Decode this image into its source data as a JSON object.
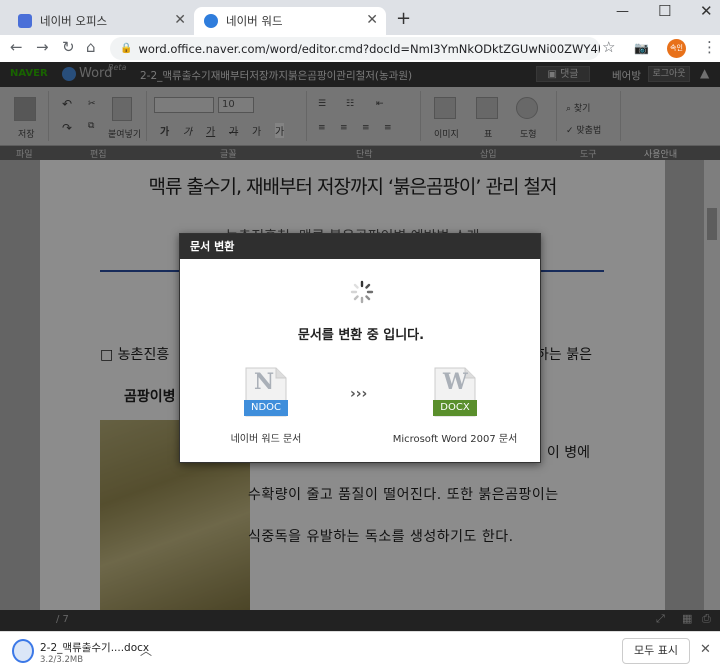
{
  "browser": {
    "tabs": [
      {
        "label": "네이버 오피스",
        "active": false
      },
      {
        "label": "네이버 워드",
        "active": true
      }
    ],
    "new_tab_glyph": "+",
    "url": "word.office.naver.com/word/editor.cmd?docId=NmI3YmNkODktZGUwNi00ZWY4LTkxNT...",
    "profile_badge": "속인"
  },
  "naver": {
    "logo": "NAVER",
    "app": "Word",
    "beta": "Beta",
    "doc_title": "2-2_맥류출수기재배부터저장까지붉은곰팡이관리철저(농과원)",
    "comment_btn": "댓글",
    "user": "베어방",
    "logout_btn": "로그아웃"
  },
  "ribbon": {
    "save": "저장",
    "paste": "붙여넣기",
    "font_size": "10",
    "char_buttons": [
      "가",
      "가",
      "가",
      "가",
      "가",
      "가"
    ],
    "image": "이미지",
    "table": "표",
    "shape": "도형",
    "find": "찾기",
    "spell": "맞춤법",
    "group_labels": [
      "파일",
      "편집",
      "글꼴",
      "단락",
      "삽입",
      "도구",
      "사용안내"
    ]
  },
  "document": {
    "title": "맥류 출수기, 재배부터 저장까지 ‘붉은곰팡이’ 관리 철저",
    "subtitle": "- 농촌진흥청, 맥류 붉은곰팡이병 예방법 소개 -",
    "para1_left": "□ 농촌진흥",
    "para1_right": "하는 붉은",
    "para2_left": "곰팡이병",
    "line3_right": ". 이 병에",
    "line4": "수확량이 줄고 품질이 떨어진다. 또한 붉은곰팡이는",
    "line5": "식중독을 유발하는 독소를 생성하기도 한다."
  },
  "status": {
    "page": "/ 7"
  },
  "modal": {
    "title": "문서 변환",
    "message": "문서를 변환 중 입니다.",
    "left_letter": "N",
    "left_ext": "NDOC",
    "left_label": "네이버 워드 문서",
    "right_letter": "W",
    "right_ext": "DOCX",
    "right_label": "Microsoft Word 2007 문서",
    "arrows": "›››"
  },
  "download": {
    "filename": "2-2_맥류출수기....docx",
    "progress": "3.2/3.2MB",
    "show_all": "모두 표시"
  },
  "colors": {
    "ndoc": "#3f8edb",
    "docx": "#5a8f2c",
    "naver_green": "#2db400"
  }
}
